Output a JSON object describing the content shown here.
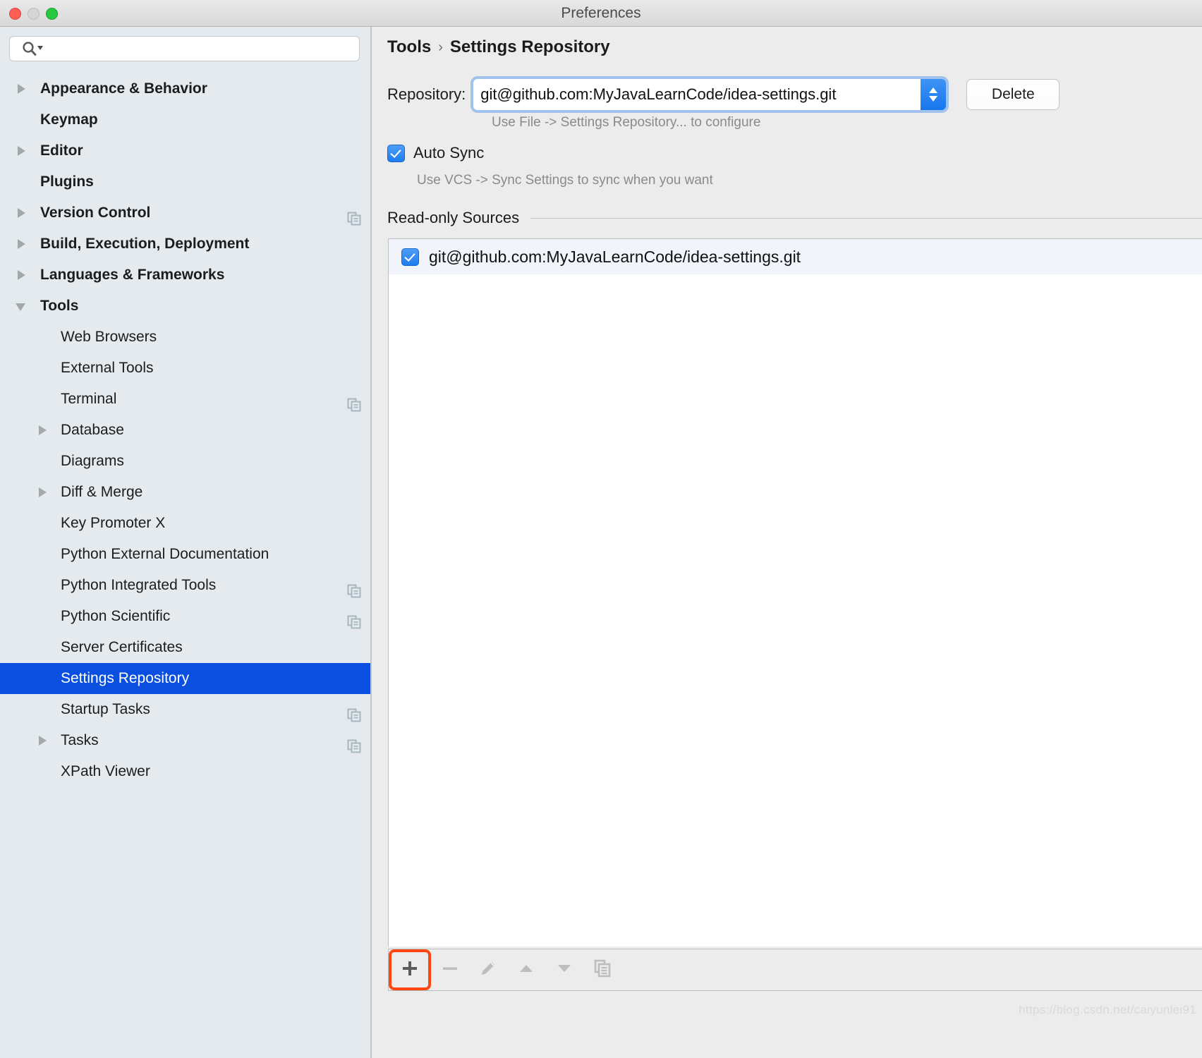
{
  "window": {
    "title": "Preferences",
    "traffic_lights": [
      "close-button",
      "minimize-button",
      "zoom-button"
    ]
  },
  "sidebar": {
    "search": {
      "value": "",
      "placeholder": "",
      "icon": "search-icon"
    },
    "items": [
      {
        "label": "Appearance & Behavior",
        "level": 0,
        "twisty": "closed",
        "selected": false,
        "badge": false
      },
      {
        "label": "Keymap",
        "level": 0,
        "twisty": "none",
        "selected": false,
        "badge": false
      },
      {
        "label": "Editor",
        "level": 0,
        "twisty": "closed",
        "selected": false,
        "badge": false
      },
      {
        "label": "Plugins",
        "level": 0,
        "twisty": "none",
        "selected": false,
        "badge": false
      },
      {
        "label": "Version Control",
        "level": 0,
        "twisty": "closed",
        "selected": false,
        "badge": true
      },
      {
        "label": "Build, Execution, Deployment",
        "level": 0,
        "twisty": "closed",
        "selected": false,
        "badge": false
      },
      {
        "label": "Languages & Frameworks",
        "level": 0,
        "twisty": "closed",
        "selected": false,
        "badge": false
      },
      {
        "label": "Tools",
        "level": 0,
        "twisty": "open",
        "selected": false,
        "badge": false
      },
      {
        "label": "Web Browsers",
        "level": 1,
        "twisty": "none",
        "selected": false,
        "badge": false
      },
      {
        "label": "External Tools",
        "level": 1,
        "twisty": "none",
        "selected": false,
        "badge": false
      },
      {
        "label": "Terminal",
        "level": 1,
        "twisty": "none",
        "selected": false,
        "badge": true
      },
      {
        "label": "Database",
        "level": 1,
        "twisty": "closed",
        "selected": false,
        "badge": false
      },
      {
        "label": "Diagrams",
        "level": 1,
        "twisty": "none",
        "selected": false,
        "badge": false
      },
      {
        "label": "Diff & Merge",
        "level": 1,
        "twisty": "closed",
        "selected": false,
        "badge": false
      },
      {
        "label": "Key Promoter X",
        "level": 1,
        "twisty": "none",
        "selected": false,
        "badge": false
      },
      {
        "label": "Python External Documentation",
        "level": 1,
        "twisty": "none",
        "selected": false,
        "badge": false
      },
      {
        "label": "Python Integrated Tools",
        "level": 1,
        "twisty": "none",
        "selected": false,
        "badge": true
      },
      {
        "label": "Python Scientific",
        "level": 1,
        "twisty": "none",
        "selected": false,
        "badge": true
      },
      {
        "label": "Server Certificates",
        "level": 1,
        "twisty": "none",
        "selected": false,
        "badge": false
      },
      {
        "label": "Settings Repository",
        "level": 1,
        "twisty": "none",
        "selected": true,
        "badge": false
      },
      {
        "label": "Startup Tasks",
        "level": 1,
        "twisty": "none",
        "selected": false,
        "badge": true
      },
      {
        "label": "Tasks",
        "level": 1,
        "twisty": "closed",
        "selected": false,
        "badge": true
      },
      {
        "label": "XPath Viewer",
        "level": 1,
        "twisty": "none",
        "selected": false,
        "badge": false
      }
    ]
  },
  "main": {
    "breadcrumb": {
      "parent": "Tools",
      "separator": "›",
      "current": "Settings Repository"
    },
    "repository": {
      "label": "Repository:",
      "value": "git@github.com:MyJavaLearnCode/idea-settings.git",
      "placeholder": "",
      "hint": "Use File -> Settings Repository... to configure",
      "delete_label": "Delete"
    },
    "auto_sync": {
      "label": "Auto Sync",
      "checked": true,
      "hint": "Use VCS -> Sync Settings to sync when you want"
    },
    "read_only_sources": {
      "title": "Read-only Sources",
      "rows": [
        {
          "checked": true,
          "text": "git@github.com:MyJavaLearnCode/idea-settings.git"
        }
      ]
    },
    "toolbar": [
      {
        "icon": "plus-icon",
        "highlighted": true,
        "enabled": true
      },
      {
        "icon": "minus-icon",
        "highlighted": false,
        "enabled": false
      },
      {
        "icon": "pencil-edit-icon",
        "highlighted": false,
        "enabled": false
      },
      {
        "icon": "arrow-up-icon",
        "highlighted": false,
        "enabled": false
      },
      {
        "icon": "arrow-down-icon",
        "highlighted": false,
        "enabled": false
      },
      {
        "icon": "copy-icon",
        "highlighted": false,
        "enabled": false
      }
    ]
  },
  "watermark": "https://blog.csdn.net/caiyunlei91",
  "colors": {
    "selection_blue": "#0a4fe0",
    "accent_blue": "#1d7cf0",
    "highlight_orange": "#ff4612",
    "sidebar_bg": "#e5eaee",
    "panel_bg": "#ececec"
  }
}
